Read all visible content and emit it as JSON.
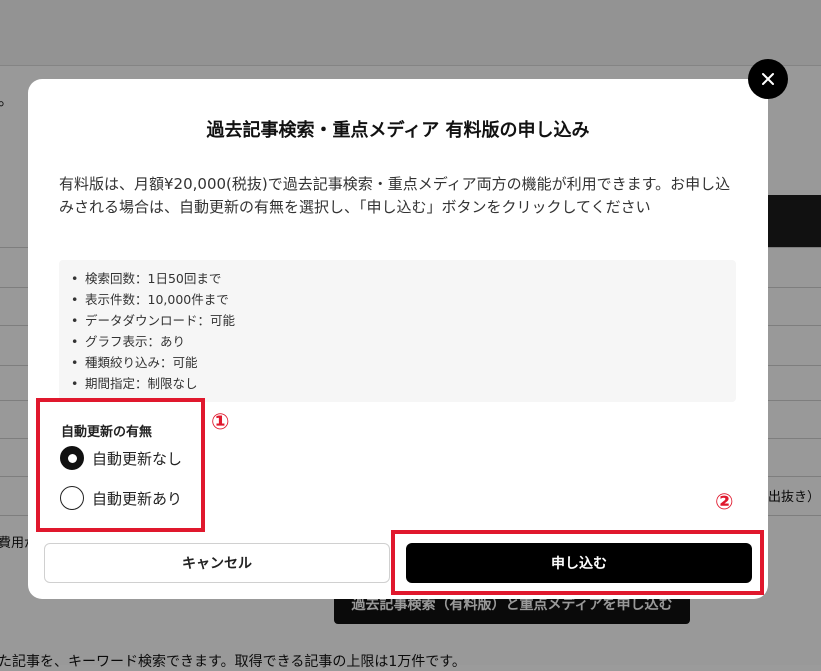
{
  "background": {
    "left_fragment": "。",
    "side_text_left": "費用が",
    "side_text_right": "出抜き）",
    "bottom_text": "た記事を、キーワード検索できます。取得できる記事の上限は1万件です。",
    "dark_button_label": "過去記事検索（有料版）と重点メディアを申し込む"
  },
  "modal": {
    "title": "過去記事検索・重点メディア 有料版の申し込み",
    "description": "有料版は、月額¥20,000(税抜)で過去記事検索・重点メディア両方の機能が利用できます。お申し込みされる場合は、自動更新の有無を選択し、「申し込む」ボタンをクリックしてください",
    "features": [
      "検索回数：1日50回まで",
      "表示件数：10,000件まで",
      "データダウンロード：可能",
      "グラフ表示：あり",
      "種類絞り込み：可能",
      "期間指定：制限なし"
    ],
    "auto_renew_label": "自動更新の有無",
    "options": [
      {
        "label": "自動更新なし",
        "selected": true
      },
      {
        "label": "自動更新あり",
        "selected": false
      }
    ],
    "cancel_label": "キャンセル",
    "submit_label": "申し込む",
    "close_icon": "close-icon"
  },
  "annotations": {
    "mark_1": "①",
    "mark_2": "②",
    "color": "#e0182d"
  }
}
